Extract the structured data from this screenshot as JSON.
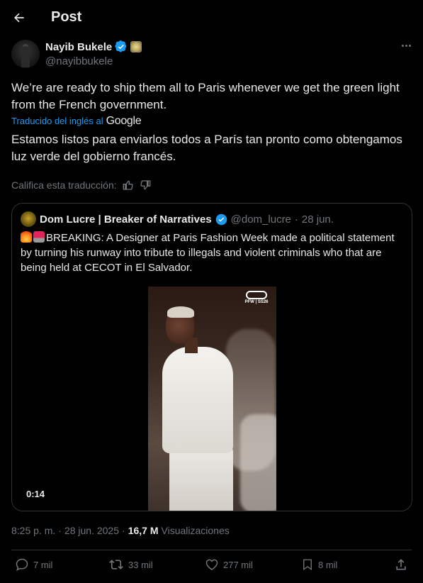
{
  "header": {
    "title": "Post"
  },
  "author": {
    "name": "Nayib Bukele",
    "handle": "@nayibbukele"
  },
  "tweet": {
    "text": "We’re are ready to ship them all to Paris whenever we get the green light from the French government.",
    "translated_label": "Traducido del inglés al",
    "translator": "Google",
    "translation": "Estamos listos para enviarlos todos a París tan pronto como obtengamos luz verde del gobierno francés.",
    "rate_label": "Califica esta traducción:"
  },
  "quote": {
    "name": "Dom Lucre | Breaker of Narratives",
    "handle": "@dom_lucre",
    "date": "28 jun.",
    "text": "BREAKING: A Designer at Paris Fashion Week made a political statement by turning his runway into tribute to illegals and violent criminals who that are being held at CECOT in El Salvador.",
    "video_duration": "0:14",
    "video_logo_text": "PFW | SS26"
  },
  "meta": {
    "time": "8:25 p. m.",
    "date": "28 jun. 2025",
    "views_count": "16,7 M",
    "views_label": "Visualizaciones"
  },
  "actions": {
    "replies": "7 mil",
    "reposts": "33 mil",
    "likes": "277 mil",
    "bookmarks": "8 mil"
  },
  "colors": {
    "background": "#000000",
    "text": "#e7e9ea",
    "muted": "#71767b",
    "accent": "#1d9bf0",
    "border": "#2f3336",
    "verified": "#1d9bf0"
  }
}
